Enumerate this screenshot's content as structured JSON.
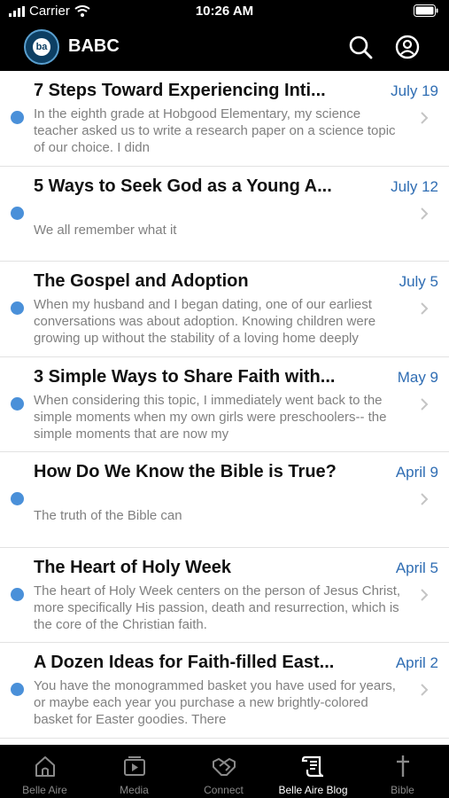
{
  "status_bar": {
    "carrier": "Carrier",
    "time": "10:26 AM"
  },
  "header": {
    "logo_text": "ba",
    "title": "BABC",
    "search_icon": "search-icon",
    "profile_icon": "user-circle-icon"
  },
  "posts": [
    {
      "title": "7 Steps Toward Experiencing Inti...",
      "date": "July 19",
      "excerpt": "In the eighth grade at Hobgood Elementary, my science teacher asked us to write a research paper on a science topic of our choice. I didn",
      "unread": true
    },
    {
      "title": "5 Ways to Seek God as a Young A...",
      "date": "July 12",
      "excerpt": "We all remember what it",
      "unread": true
    },
    {
      "title": "The Gospel and Adoption",
      "date": "July 5",
      "excerpt": "When my husband and I began dating, one of our earliest conversations was about adoption. Knowing children were growing up without the stability of a loving home deeply",
      "unread": true
    },
    {
      "title": "3 Simple Ways to Share Faith with...",
      "date": "May 9",
      "excerpt": "When considering this topic, I immediately went back to the simple moments when my own girls were preschoolers-- the simple moments that are now my",
      "unread": true
    },
    {
      "title": "How Do We Know the Bible is True?",
      "date": "April 9",
      "excerpt": "The truth of the Bible can",
      "unread": true
    },
    {
      "title": "The Heart of Holy Week",
      "date": "April 5",
      "excerpt": "The heart of Holy Week centers on the person of Jesus Christ, more specifically His passion, death and resurrection, which is the core of the Christian faith.",
      "unread": true
    },
    {
      "title": "A Dozen Ideas for Faith-filled East...",
      "date": "April 2",
      "excerpt": "You have the monogrammed basket you have used for years, or maybe each year you purchase a new brightly-colored basket for Easter goodies. There",
      "unread": true
    }
  ],
  "tabs": [
    {
      "label": "Belle Aire",
      "icon": "home-icon",
      "active": false
    },
    {
      "label": "Media",
      "icon": "play-tv-icon",
      "active": false
    },
    {
      "label": "Connect",
      "icon": "handshake-icon",
      "active": false
    },
    {
      "label": "Belle Aire Blog",
      "icon": "scroll-icon",
      "active": true
    },
    {
      "label": "Bible",
      "icon": "cross-icon",
      "active": false
    }
  ],
  "colors": {
    "accent": "#2f6db3",
    "unread_dot": "#4a90d9",
    "bar": "#000000"
  }
}
